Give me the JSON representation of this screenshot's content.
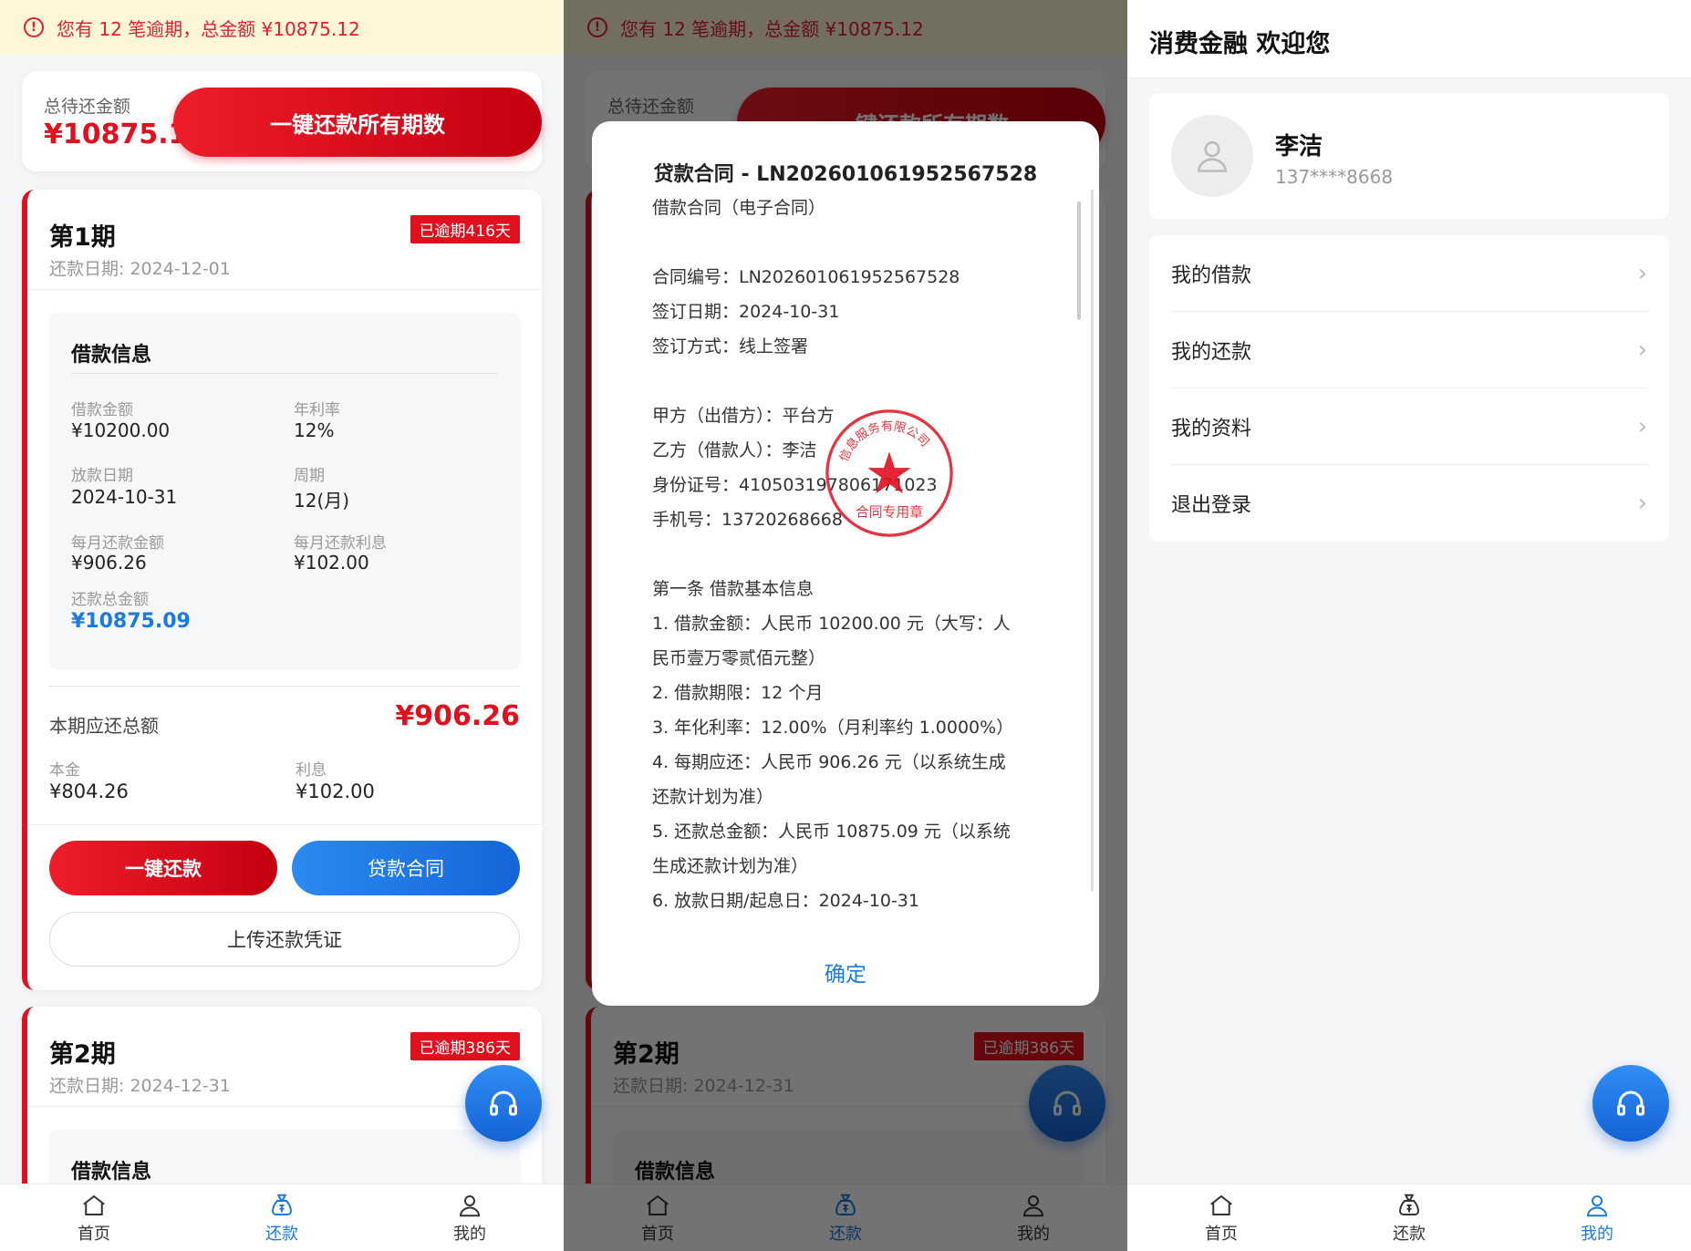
{
  "notice": {
    "text": "您有 12 笔逾期，总金额 ¥10875.12"
  },
  "total": {
    "label": "总待还金额",
    "amount": "¥10875.12",
    "pay_all": "一键还款所有期数"
  },
  "periods": [
    {
      "title": "第1期",
      "date": "还款日期: 2024-12-01",
      "badge": "已逾期416天",
      "loan_info_title": "借款信息",
      "fields": {
        "loan_amount_label": "借款金额",
        "loan_amount": "¥10200.00",
        "rate_label": "年利率",
        "rate": "12%",
        "date_label": "放款日期",
        "date": "2024-10-31",
        "cycle_label": "周期",
        "cycle": "12(月)",
        "monthly_label": "每月还款金额",
        "monthly": "¥906.26",
        "interest_label": "每月还款利息",
        "interest": "¥102.00",
        "total_label": "还款总金额",
        "total": "¥10875.09"
      },
      "due_label": "本期应还总额",
      "due_amount": "¥906.26",
      "principal_label": "本金",
      "principal": "¥804.26",
      "interest2_label": "利息",
      "interest2": "¥102.00",
      "pay_btn": "一键还款",
      "contract_btn": "贷款合同",
      "upload_btn": "上传还款凭证"
    },
    {
      "title": "第2期",
      "date": "还款日期: 2024-12-31",
      "badge": "已逾期386天",
      "loan_info_title": "借款信息"
    }
  ],
  "tabs": [
    {
      "label": "首页",
      "icon": "home-icon"
    },
    {
      "label": "还款",
      "icon": "money-bag-icon"
    },
    {
      "label": "我的",
      "icon": "user-icon"
    }
  ],
  "modal": {
    "title": "贷款合同 - LN202601061952567528",
    "lines": [
      "借款合同（电子合同）",
      "",
      "合同编号：LN202601061952567528",
      "签订日期：2024-10-31",
      "签订方式：线上签署",
      "",
      "甲方（出借方）：平台方",
      "乙方（借款人）：李洁",
      "身份证号：410503197806171023",
      "手机号：13720268668",
      "",
      "第一条 借款基本信息",
      "1. 借款金额：人民币 10200.00 元（大写：人",
      "民币壹万零贰佰元整）",
      "2. 借款期限：12 个月",
      "3. 年化利率：12.00%（月利率约 1.0000%）",
      "4. 每期应还：人民币 906.26 元（以系统生成",
      "还款计划为准）",
      "5. 还款总金额：人民币 10875.09 元（以系统",
      "生成还款计划为准）",
      "6. 放款日期/起息日：2024-10-31"
    ],
    "ok": "确定",
    "seal_text": "合同专用章",
    "seal_ring": "信息服务有限公司"
  },
  "profile_page": {
    "header": "消费金融 欢迎您",
    "name": "李洁",
    "phone": "137****8668",
    "menu": [
      "我的借款",
      "我的还款",
      "我的资料",
      "退出登录"
    ]
  },
  "colors": {
    "accent_red": "#e0101e",
    "accent_blue": "#1a7ae0",
    "notice_bg": "#fdf6d8"
  }
}
